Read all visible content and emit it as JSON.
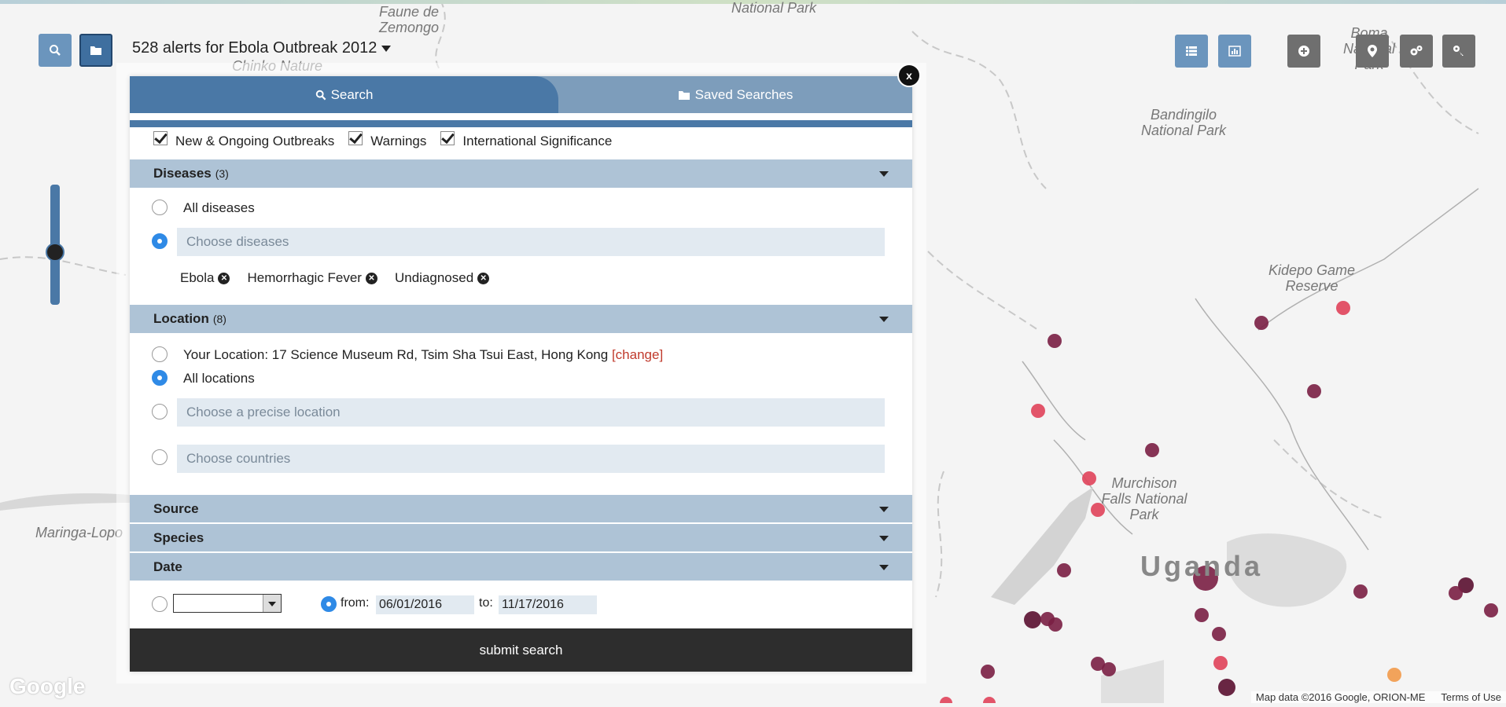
{
  "header": {
    "title": "528 alerts for",
    "search_name": "Ebola Outbreak 2012"
  },
  "toolbar_left": [
    {
      "icon": "search-icon"
    },
    {
      "icon": "folder-icon"
    }
  ],
  "toolbar_right": [
    {
      "icon": "list-icon"
    },
    {
      "icon": "chart-icon"
    },
    {
      "icon": "plus-circle-icon"
    },
    {
      "icon": "map-marker-icon"
    },
    {
      "icon": "cogs-icon"
    },
    {
      "icon": "key-icon"
    }
  ],
  "modal": {
    "close_label": "x",
    "tabs": [
      {
        "label": "Search",
        "icon": "search-icon"
      },
      {
        "label": "Saved Searches",
        "icon": "folder-icon"
      }
    ],
    "filters": [
      {
        "label": "New & Ongoing Outbreaks",
        "checked": true
      },
      {
        "label": "Warnings",
        "checked": true
      },
      {
        "label": "International Significance",
        "checked": true
      }
    ],
    "diseases": {
      "title": "Diseases",
      "count": "(3)",
      "all_label": "All diseases",
      "choose_placeholder": "Choose diseases",
      "tags": [
        "Ebola",
        "Hemorrhagic Fever",
        "Undiagnosed"
      ]
    },
    "location": {
      "title": "Location",
      "count": "(8)",
      "your_location_label": "Your Location: 17 Science Museum Rd, Tsim Sha Tsui East, Hong Kong",
      "change_label": "[change]",
      "all_label": "All locations",
      "precise_placeholder": "Choose a precise location",
      "countries_placeholder": "Choose countries"
    },
    "source": {
      "title": "Source"
    },
    "species": {
      "title": "Species"
    },
    "date": {
      "title": "Date",
      "from_label": "from:",
      "from_value": "06/01/2016",
      "to_label": "to:",
      "to_value": "11/17/2016"
    },
    "submit_label": "submit search"
  },
  "map": {
    "labels": [
      "Faune de Zemongo",
      "Chinko Nature",
      "National Park",
      "Boma National Park",
      "Bandingilo National Park",
      "Kidepo Game Reserve",
      "Murchison Falls National Park",
      "Maringa-Lopo"
    ],
    "country_label": "Uganda",
    "google_logo": "Google",
    "attribution": "Map data ©2016 Google, ORION-ME",
    "terms": "Terms of Use",
    "marker_colors": [
      "#e0435a",
      "#7a1f44",
      "#5a1030",
      "#f29a4a"
    ]
  }
}
